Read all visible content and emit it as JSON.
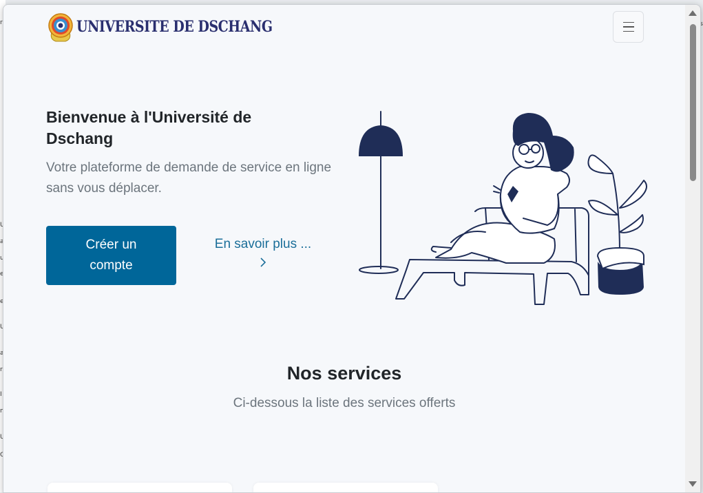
{
  "header": {
    "brand_name": "UNIVERSITE DE DSCHANG"
  },
  "hero": {
    "title": "Bienvenue à l'Université de Dschang",
    "subtitle": "Votre plateforme de demande de service en ligne sans vous déplacer.",
    "primary_button_label": "Créer un compte",
    "link_label": "En savoir plus ..."
  },
  "services": {
    "title": "Nos services",
    "subtitle": "Ci-dessous la liste des services offerts"
  },
  "background_app": {
    "fragments": [
      "r",
      "U",
      "a",
      "u",
      "el",
      "e",
      "U",
      "a",
      "r",
      "I",
      "n",
      "U",
      "C",
      "s"
    ]
  },
  "colors": {
    "primary": "#006699",
    "link": "#1a6e99",
    "brand_text": "#2a2f6f",
    "illustration_navy": "#1f2d57",
    "heading": "#212529",
    "muted": "#6c757d"
  },
  "icons": {
    "menu": "hamburger-icon",
    "link_arrow": "chevron-right-icon",
    "logo": "university-seal"
  }
}
